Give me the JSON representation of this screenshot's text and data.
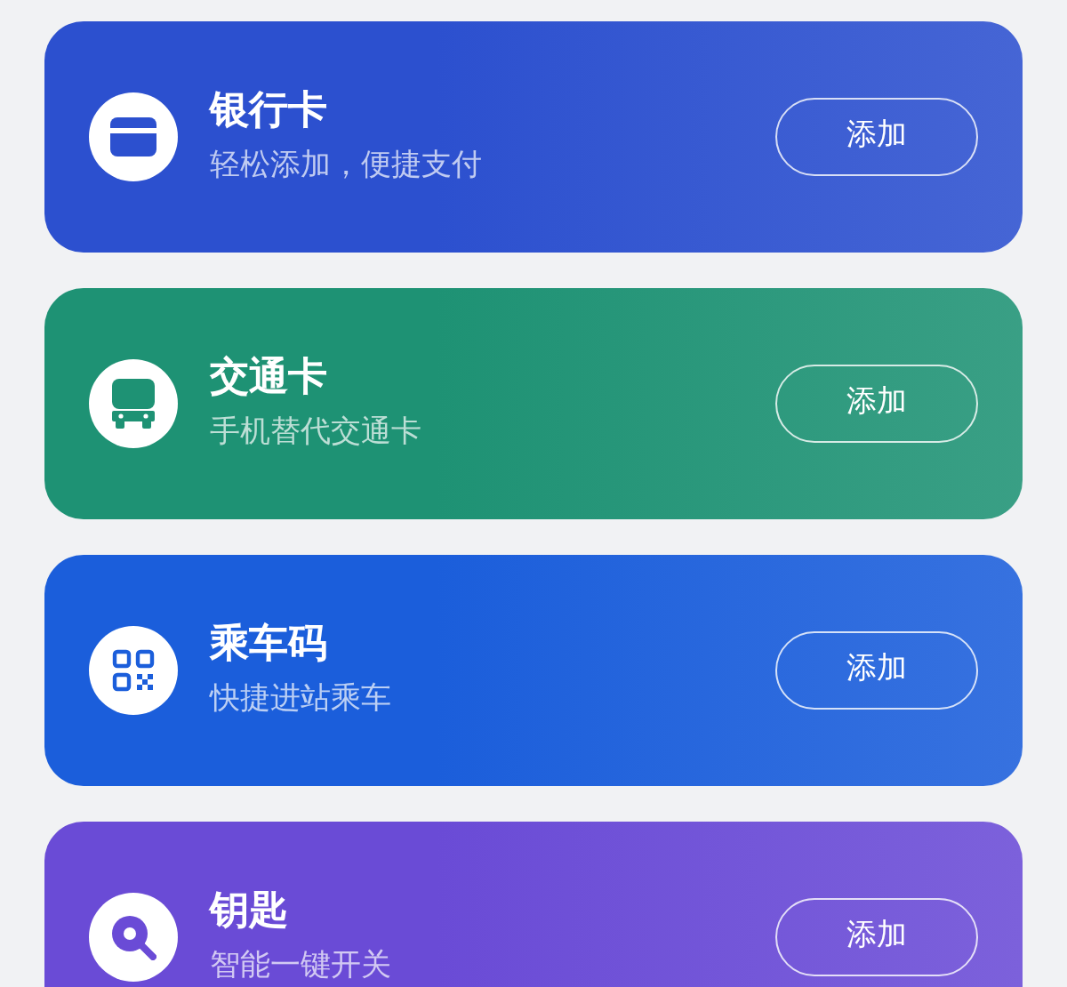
{
  "cards": [
    {
      "kind": "bank",
      "title": "银行卡",
      "subtitle": "轻松添加，便捷支付",
      "button": "添加",
      "color": "#2c50cf"
    },
    {
      "kind": "transit",
      "title": "交通卡",
      "subtitle": "手机替代交通卡",
      "button": "添加",
      "color": "#1e9274"
    },
    {
      "kind": "qr",
      "title": "乘车码",
      "subtitle": "快捷进站乘车",
      "button": "添加",
      "color": "#1b5edb"
    },
    {
      "kind": "key",
      "title": "钥匙",
      "subtitle": "智能一键开关",
      "button": "添加",
      "color": "#6a4bd6"
    }
  ]
}
